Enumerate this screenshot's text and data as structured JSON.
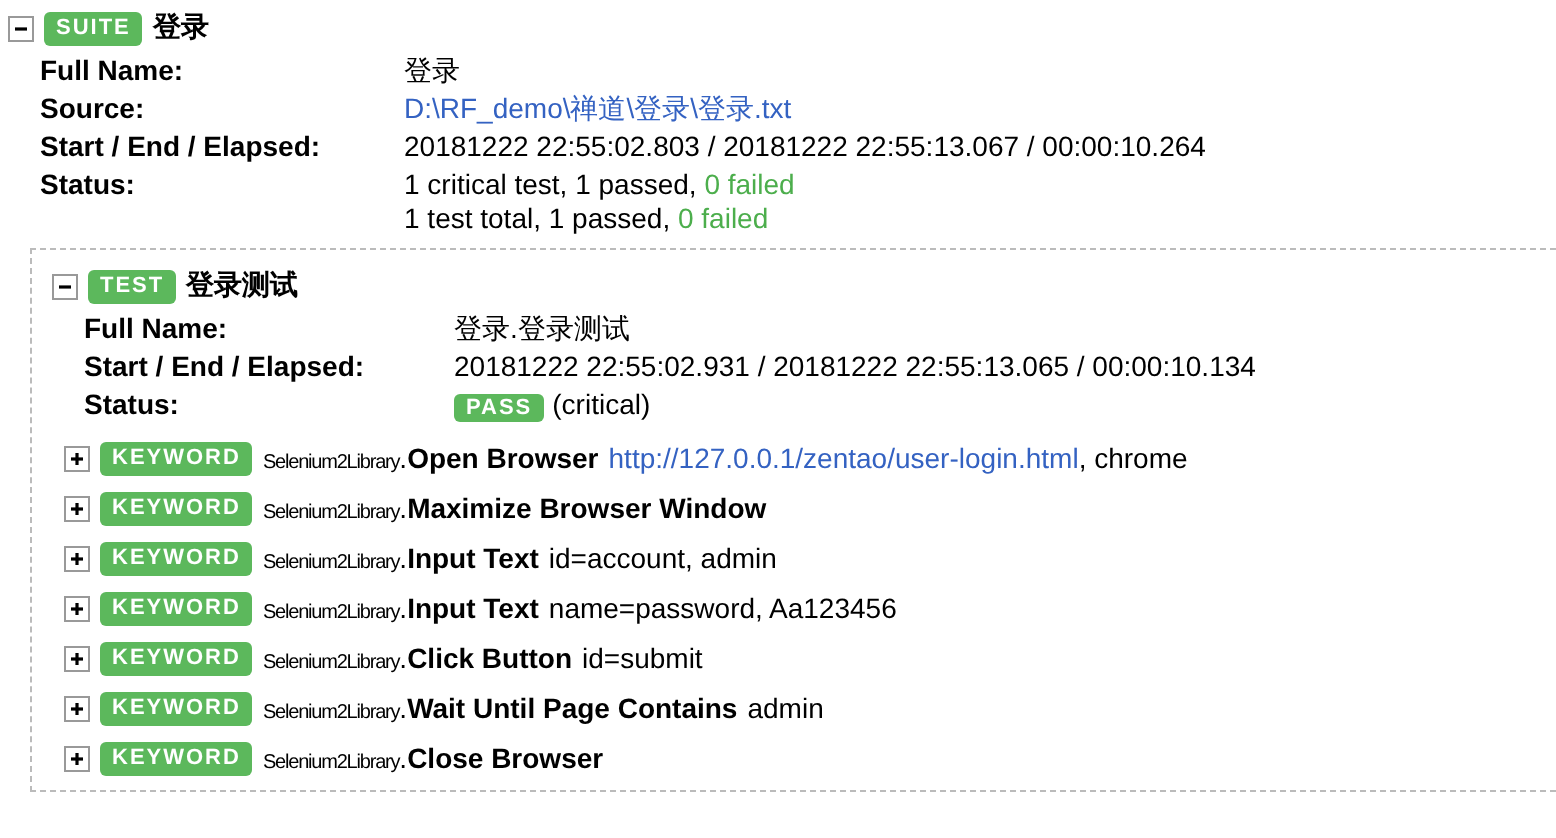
{
  "suite": {
    "expanded": true,
    "badge": "SUITE",
    "name": "登录",
    "metadata": [
      {
        "label": "Full Name:",
        "value": [
          {
            "kind": "text",
            "text": "登录"
          }
        ]
      },
      {
        "label": "Source:",
        "value": [
          {
            "kind": "link",
            "text": "D:\\RF_demo\\禅道\\登录\\登录.txt"
          }
        ]
      },
      {
        "label": "Start / End / Elapsed:",
        "value": [
          {
            "kind": "text",
            "text": "20181222 22:55:02.803 / 20181222 22:55:13.067 / 00:00:10.264"
          }
        ]
      },
      {
        "label": "Status:",
        "value": [
          {
            "kind": "stat",
            "text": "1 critical test, 1 passed, ",
            "failed": "0 failed"
          },
          {
            "kind": "stat",
            "text": "1 test total, 1 passed, ",
            "failed": "0 failed"
          }
        ]
      }
    ],
    "test": {
      "expanded": true,
      "badge": "TEST",
      "name": "登录测试",
      "metadata": [
        {
          "label": "Full Name:",
          "value": [
            {
              "kind": "text",
              "text": "登录.登录测试"
            }
          ]
        },
        {
          "label": "Start / End / Elapsed:",
          "value": [
            {
              "kind": "text",
              "text": "20181222 22:55:02.931 / 20181222 22:55:13.065 / 00:00:10.134"
            }
          ]
        },
        {
          "label": "Status:",
          "value": [
            {
              "kind": "status",
              "badge": "PASS",
              "text": "(critical)"
            }
          ]
        }
      ],
      "keywords": [
        {
          "expanded": false,
          "badge": "KEYWORD",
          "library": "Selenium2Library",
          "dot": ".",
          "name": "Open Browser",
          "args": [
            {
              "kind": "link",
              "text": "http://127.0.0.1/zentao/user-login.html"
            },
            {
              "kind": "text",
              "text": ", chrome"
            }
          ]
        },
        {
          "expanded": false,
          "badge": "KEYWORD",
          "library": "Selenium2Library",
          "dot": ".",
          "name": "Maximize Browser Window"
        },
        {
          "expanded": false,
          "badge": "KEYWORD",
          "library": "Selenium2Library",
          "dot": ".",
          "name": "Input Text",
          "args": [
            {
              "kind": "text",
              "text": "id=account, admin"
            }
          ]
        },
        {
          "expanded": false,
          "badge": "KEYWORD",
          "library": "Selenium2Library",
          "dot": ".",
          "name": "Input Text",
          "args": [
            {
              "kind": "text",
              "text": "name=password, Aa123456"
            }
          ]
        },
        {
          "expanded": false,
          "badge": "KEYWORD",
          "library": "Selenium2Library",
          "dot": ".",
          "name": "Click Button",
          "args": [
            {
              "kind": "text",
              "text": "id=submit"
            }
          ]
        },
        {
          "expanded": false,
          "badge": "KEYWORD",
          "library": "Selenium2Library",
          "dot": ".",
          "name": "Wait Until Page Contains",
          "args": [
            {
              "kind": "text",
              "text": "admin"
            }
          ]
        },
        {
          "expanded": false,
          "badge": "KEYWORD",
          "library": "Selenium2Library",
          "dot": ".",
          "name": "Close Browser"
        }
      ]
    }
  }
}
